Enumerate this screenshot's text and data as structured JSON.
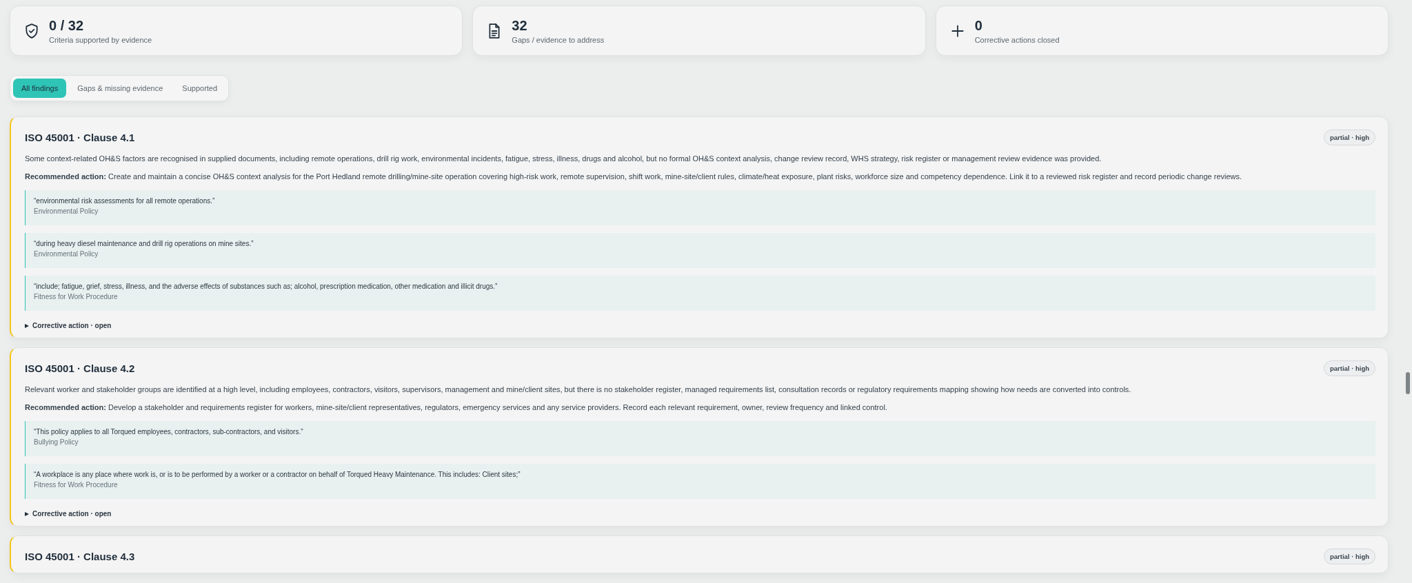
{
  "stats": [
    {
      "kind": "shield",
      "value": "0 / 32",
      "label": "Criteria supported by evidence"
    },
    {
      "kind": "document",
      "value": "32",
      "label": "Gaps / evidence to address"
    },
    {
      "kind": "plus",
      "value": "0",
      "label": "Corrective actions closed"
    }
  ],
  "tabs": [
    {
      "label": "All findings",
      "selected": true
    },
    {
      "label": "Gaps & missing evidence",
      "selected": false
    },
    {
      "label": "Supported",
      "selected": false
    }
  ],
  "findings": [
    {
      "title": "ISO 45001 · Clause 4.1",
      "badge": "partial · high",
      "summary": "Some context-related OH&S factors are recognised in supplied documents, including remote operations, drill rig work, environmental incidents, fatigue, stress, illness, drugs and alcohol, but no formal OH&S context analysis, change review record, WHS strategy, risk register or management review evidence was provided.",
      "recommendation": "**Recommended action:** Create and maintain a concise OH&S context analysis for the Port Hedland remote drilling/mine-site operation covering high-risk work, remote supervision, shift work, mine-site/client rules, climate/heat exposure, plant risks, workforce size and competency dependence. Link it to a reviewed risk register and record periodic change reviews.",
      "quotes": [
        {
          "text": "“environmental risk assessments for all remote operations.”",
          "source": "Environmental Policy"
        },
        {
          "text": "“during heavy diesel maintenance and drill rig operations on mine sites.”",
          "source": "Environmental Policy"
        },
        {
          "text": "“include; fatigue, grief, stress, illness, and the adverse effects of substances such as; alcohol, prescription medication, other medication and illicit drugs.”",
          "source": "Fitness for Work Procedure"
        }
      ],
      "corrective": {
        "label": "Corrective action · open",
        "expanded": false
      }
    },
    {
      "title": "ISO 45001 · Clause 4.2",
      "badge": "partial · high",
      "summary": "Relevant worker and stakeholder groups are identified at a high level, including employees, contractors, visitors, supervisors, management and mine/client sites, but there is no stakeholder register, managed requirements list, consultation records or regulatory requirements mapping showing how needs are converted into controls.",
      "recommendation": "**Recommended action:** Develop a stakeholder and requirements register for workers, mine-site/client representatives, regulators, emergency services and any service providers. Record each relevant requirement, owner, review frequency and linked control.",
      "quotes": [
        {
          "text": "“This policy applies to all Torqued employees, contractors, sub-contractors, and visitors.”",
          "source": "Bullying Policy"
        },
        {
          "text": "“A workplace is any place where work is, or is to be performed by a worker or a contractor on behalf of Torqued Heavy Maintenance. This includes: Client sites;”",
          "source": "Fitness for Work Procedure"
        }
      ],
      "corrective": {
        "label": "Corrective action · open",
        "expanded": false
      }
    },
    {
      "title": "ISO 45001 · Clause 4.3",
      "badge": "partial · high"
    }
  ]
}
